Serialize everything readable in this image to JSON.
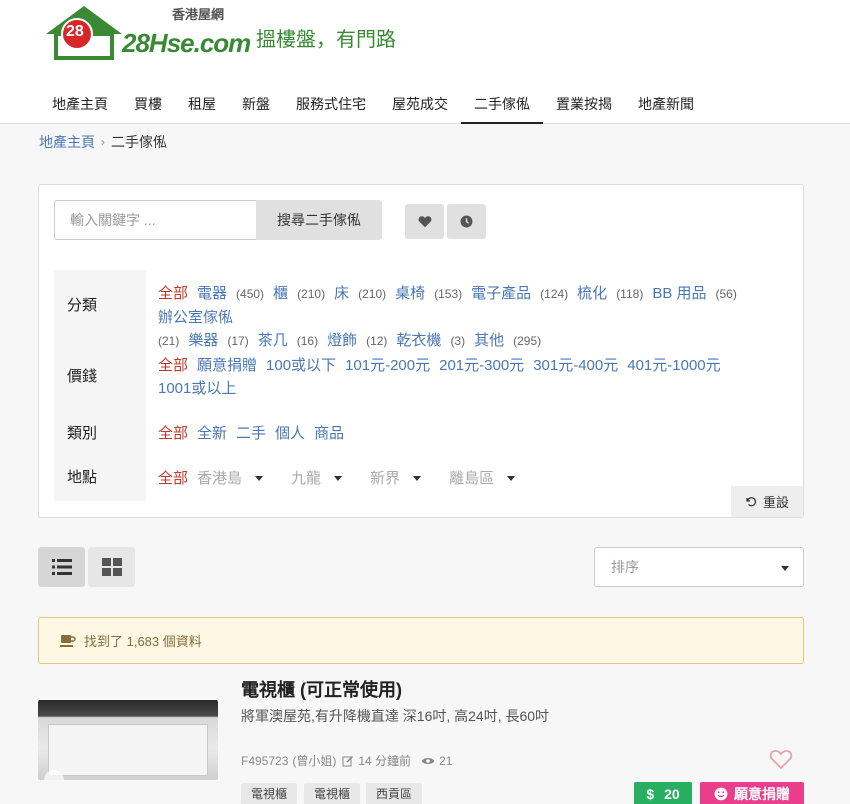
{
  "site": {
    "logo_number": "28",
    "logo_text": "28Hse.com",
    "logo_sub": "香港屋網",
    "slogan": "搵樓盤，有門路"
  },
  "nav": [
    "地產主頁",
    "買樓",
    "租屋",
    "新盤",
    "服務式住宅",
    "屋苑成交",
    "二手傢俬",
    "置業按揭",
    "地產新聞"
  ],
  "breadcrumb": {
    "home": "地產主頁",
    "current": "二手傢俬"
  },
  "search": {
    "placeholder": "輸入關鍵字 ...",
    "button": "搜尋二手傢俬"
  },
  "filters": {
    "category": {
      "label": "分類",
      "all": "全部",
      "items": [
        {
          "name": "電器",
          "count": "(450)"
        },
        {
          "name": "櫃",
          "count": "(210)"
        },
        {
          "name": "床",
          "count": "(210)"
        },
        {
          "name": "桌椅",
          "count": "(153)"
        },
        {
          "name": "電子產品",
          "count": "(124)"
        },
        {
          "name": "梳化",
          "count": "(118)"
        },
        {
          "name": "BB 用品",
          "count": "(56)"
        },
        {
          "name": "辦公室傢俬",
          "count": "(21)"
        },
        {
          "name": "樂器",
          "count": "(17)"
        },
        {
          "name": "茶几",
          "count": "(16)"
        },
        {
          "name": "燈飾",
          "count": "(12)"
        },
        {
          "name": "乾衣機",
          "count": "(3)"
        },
        {
          "name": "其他",
          "count": "(295)"
        }
      ]
    },
    "price": {
      "label": "價錢",
      "all": "全部",
      "items": [
        "願意捐贈",
        "100或以下",
        "101元-200元",
        "201元-300元",
        "301元-400元",
        "401元-1000元",
        "1001或以上"
      ]
    },
    "type": {
      "label": "類別",
      "all": "全部",
      "items": [
        "全新",
        "二手",
        "個人",
        "商品"
      ]
    },
    "location": {
      "label": "地點",
      "all": "全部",
      "items": [
        "香港島",
        "九龍",
        "新界",
        "離島區"
      ]
    },
    "reset": "重設"
  },
  "sort": {
    "placeholder": "排序"
  },
  "result": {
    "text": "找到了 1,683 個資料"
  },
  "listing": {
    "title": "電視櫃 (可正常使用)",
    "desc": "將軍澳屋苑,有升降機直達 深16吋, 高24吋, 長60吋",
    "id": "F495723",
    "user": "(曾小姐)",
    "time": "14 分鐘前",
    "views": "21",
    "tags": [
      "電視櫃",
      "電視櫃",
      "西貢區"
    ],
    "price": "20",
    "donate": "願意捐贈"
  },
  "colors": {
    "brand_green": "#3a8a35",
    "link": "#4a78b4",
    "selected": "#c0392b",
    "price": "#27ae60",
    "donate": "#e83e8c"
  }
}
